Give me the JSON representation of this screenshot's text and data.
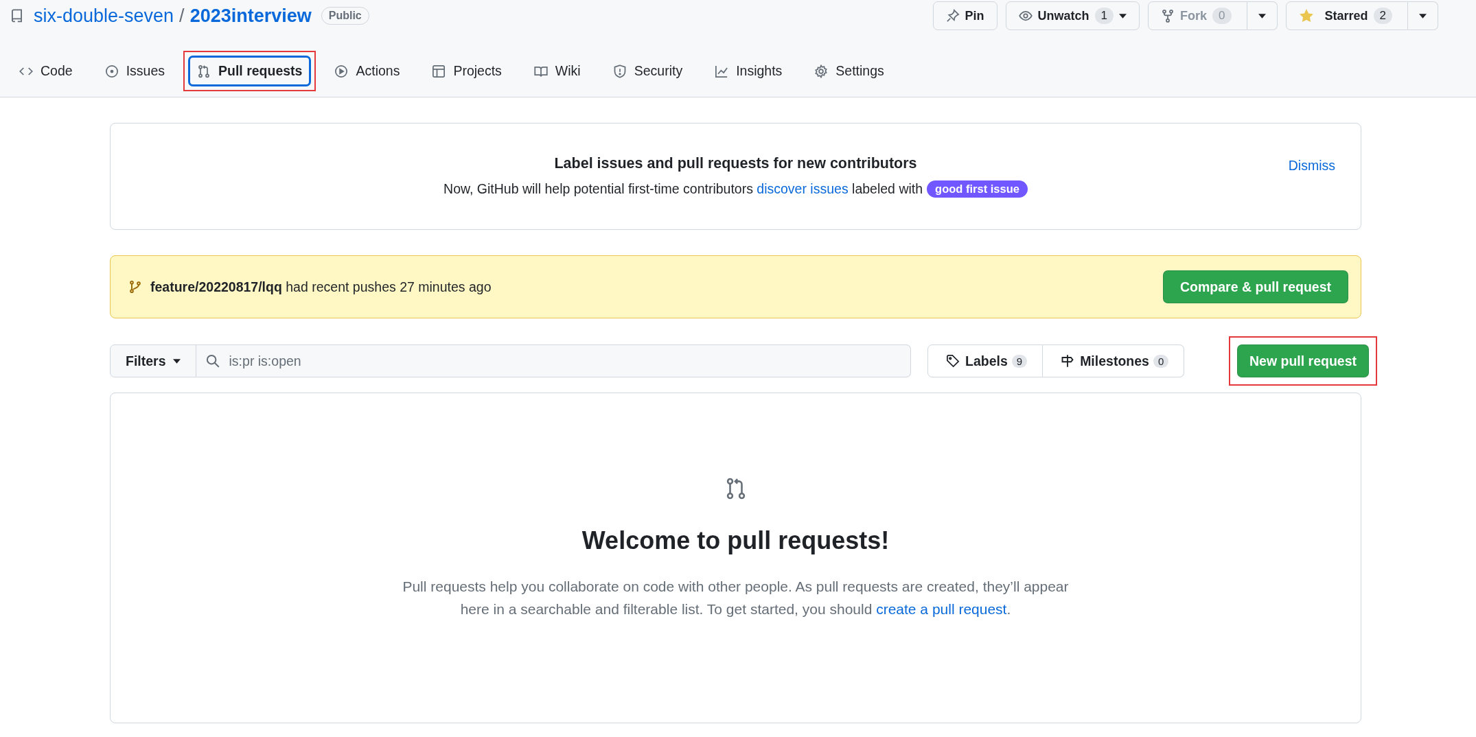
{
  "repo": {
    "owner": "six-double-seven",
    "separator": "/",
    "name": "2023interview",
    "visibility": "Public"
  },
  "actions": [
    {
      "label": "Pin",
      "kind": "plain",
      "disabled": false
    },
    {
      "label": "Unwatch",
      "count": "1",
      "kind": "dropdown",
      "disabled": false
    },
    {
      "label": "Fork",
      "count": "0",
      "kind": "split",
      "disabled": true
    },
    {
      "label": "Starred",
      "count": "2",
      "kind": "split",
      "disabled": false
    }
  ],
  "tabs": [
    {
      "label": "Code",
      "selected": false,
      "highlighted": false
    },
    {
      "label": "Issues",
      "selected": false,
      "highlighted": false
    },
    {
      "label": "Pull requests",
      "selected": true,
      "highlighted": true
    },
    {
      "label": "Actions",
      "selected": false,
      "highlighted": false
    },
    {
      "label": "Projects",
      "selected": false,
      "highlighted": false
    },
    {
      "label": "Wiki",
      "selected": false,
      "highlighted": false
    },
    {
      "label": "Security",
      "selected": false,
      "highlighted": false
    },
    {
      "label": "Insights",
      "selected": false,
      "highlighted": false
    },
    {
      "label": "Settings",
      "selected": false,
      "highlighted": false
    }
  ],
  "contributor_banner": {
    "title": "Label issues and pull requests for new contributors",
    "text": "Now, GitHub will help potential first-time contributors ",
    "link": "discover issues",
    "text_after": " labeled with",
    "label": "good first issue",
    "dismiss": "Dismiss"
  },
  "push_notice": {
    "message": "**feature/20220817/lqq** had recent pushes 27 minutes ago",
    "button": "Compare & pull request"
  },
  "toolbar": {
    "filters": "Filters",
    "search_value": "is:pr is:open",
    "labels": {
      "label": "Labels",
      "count": "9"
    },
    "milestones": {
      "label": "Milestones",
      "count": "0"
    },
    "new_button": {
      "label": "New pull request",
      "highlighted": true
    }
  },
  "empty_state": {
    "title": "Welcome to pull requests!",
    "text": "Pull requests help you collaborate on code with other people. As pull requests are created, they’ll appear here in a searchable and filterable list. To get started, you should ",
    "link": "create a pull request",
    "text_after": "."
  }
}
